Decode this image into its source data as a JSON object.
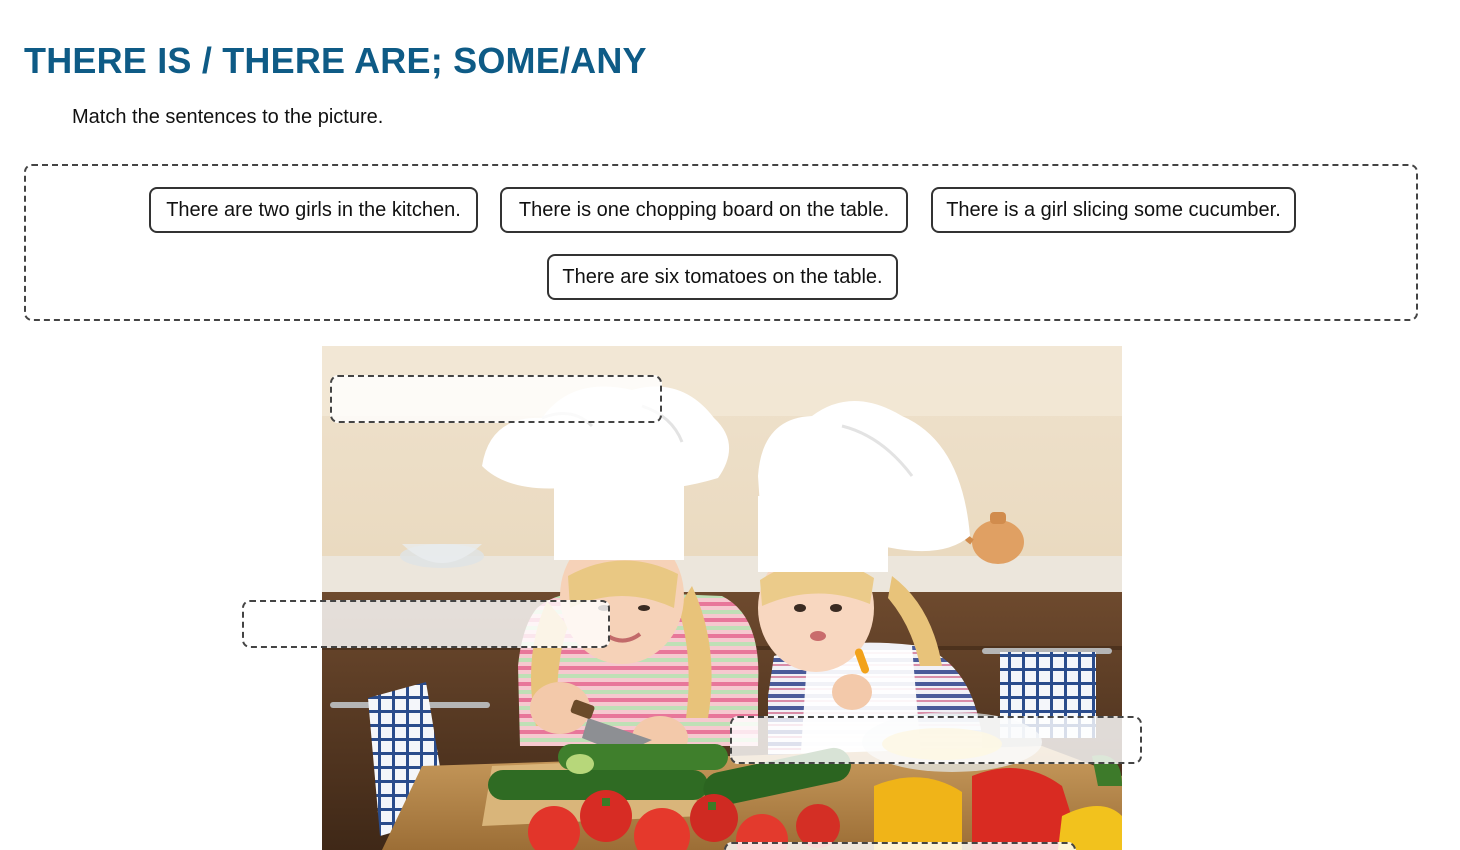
{
  "worksheet": {
    "title": "THERE IS / THERE ARE; SOME/ANY",
    "instruction": "Match the sentences to the picture."
  },
  "word_bank": {
    "options": [
      "There are two girls in the kitchen.",
      "There is one chopping board on the table.",
      "There is a girl slicing some cucumber.",
      "There are six tomatoes on the table."
    ]
  },
  "picture": {
    "subject": "two girls in chef hats cutting vegetables in a kitchen",
    "drop_zone_count": 4
  },
  "colors": {
    "title": "#0e5b86",
    "border": "#444444"
  }
}
